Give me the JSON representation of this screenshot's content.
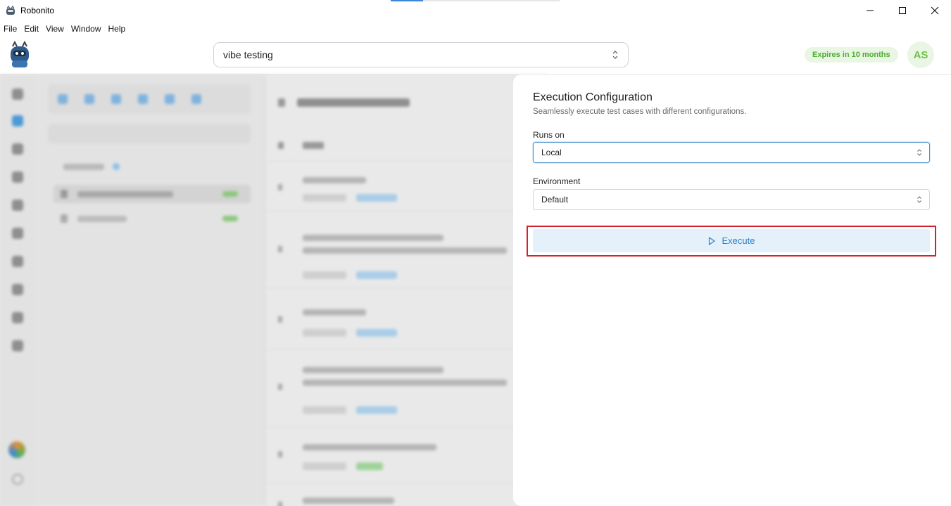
{
  "window": {
    "title": "Robonito",
    "controls": [
      "minimize-icon",
      "maximize-icon",
      "close-icon"
    ]
  },
  "menu": [
    "File",
    "Edit",
    "View",
    "Window",
    "Help"
  ],
  "header": {
    "project": "vibe testing",
    "expires_badge": "Expires in 10 months",
    "avatar_initials": "AS"
  },
  "panel": {
    "title": "Execution Configuration",
    "subtitle": "Seamlessly execute test cases with different configurations.",
    "runs_on_label": "Runs on",
    "runs_on_value": "Local",
    "environment_label": "Environment",
    "environment_value": "Default",
    "execute_label": "Execute"
  },
  "colors": {
    "accent_blue": "#2f7fc4",
    "execute_bg": "#e4f1fb",
    "highlight_red": "#d3222e",
    "badge_green": "#4cae2e",
    "badge_bg": "#eaf6e4"
  }
}
